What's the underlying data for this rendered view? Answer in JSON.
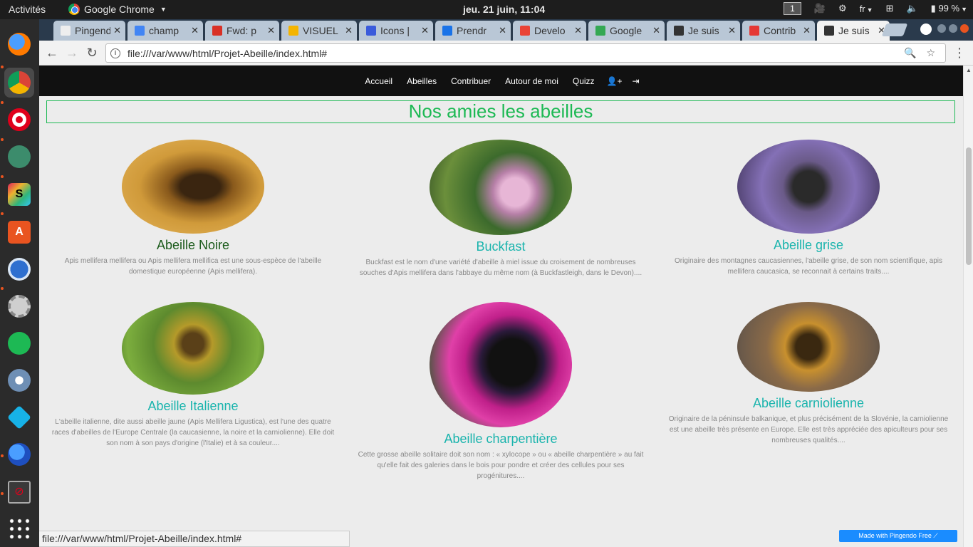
{
  "topbar": {
    "activities": "Activités",
    "app_name": "Google Chrome",
    "clock": "jeu. 21 juin, 11:04",
    "workspace": "1",
    "lang": "fr",
    "battery": "99 %"
  },
  "tabs": [
    {
      "label": "Pingendo",
      "color": "#eeeeee"
    },
    {
      "label": "champ",
      "color": "#4285f4"
    },
    {
      "label": "Fwd: p",
      "color": "#d93025"
    },
    {
      "label": "VISUEL",
      "color": "#f4b400"
    },
    {
      "label": "Icons |",
      "color": "#3b5bdb"
    },
    {
      "label": "Prendr",
      "color": "#1a73e8"
    },
    {
      "label": "Develo",
      "color": "#ea4335"
    },
    {
      "label": "Google",
      "color": "#34a853"
    },
    {
      "label": "Je suis",
      "color": "#333333"
    },
    {
      "label": "Contrib",
      "color": "#e53935"
    },
    {
      "label": "Je suis",
      "color": "#333333"
    }
  ],
  "toolbar": {
    "url": "file:///var/www/html/Projet-Abeille/index.html#"
  },
  "site": {
    "nav": [
      "Accueil",
      "Abeilles",
      "Contribuer",
      "Autour de moi",
      "Quizz"
    ],
    "headline": "Nos amies les abeilles",
    "cards": [
      {
        "title": "Abeille Noire",
        "text": "Apis mellifera mellifera ou Apis mellifera mellifica est une sous-espèce de l'abeille domestique européenne (Apis mellifera)."
      },
      {
        "title": "Buckfast",
        "text": "Buckfast est le nom d'une variété d'abeille à miel issue du croisement de nombreuses souches d'Apis mellifera dans l'abbaye du même nom (à Buckfastleigh, dans le Devon)...."
      },
      {
        "title": "Abeille grise",
        "text": "Originaire des montagnes caucasiennes, l'abeille grise, de son nom scientifique, apis mellifera caucasica, se reconnait à certains traits...."
      },
      {
        "title": "Abeille Italienne",
        "text": "L'abeille italienne, dite aussi abeille jaune (Apis Mellifera Ligustica), est l'une des quatre races d'abeilles de l'Europe Centrale (la caucasienne, la noire et la carniolienne). Elle doit son nom à son pays d'origine (l'Italie) et à sa couleur...."
      },
      {
        "title": "Abeille charpentière",
        "text": "Cette grosse abeille solitaire doit son nom : « xylocope » ou « abeille charpentière » au fait qu'elle fait des galeries dans le bois pour pondre et créer des cellules pour ses progénitures...."
      },
      {
        "title": "Abeille carniolienne",
        "text": "Originaire de la péninsule balkanique, et plus précisément de la Slovénie, la carniolienne est une abeille très présente en Europe. Elle est très appréciée des apiculteurs pour ses nombreuses qualités...."
      }
    ]
  },
  "status_url": "file:///var/www/html/Projet-Abeille/index.html#",
  "badge": "Made with Pingendo Free"
}
